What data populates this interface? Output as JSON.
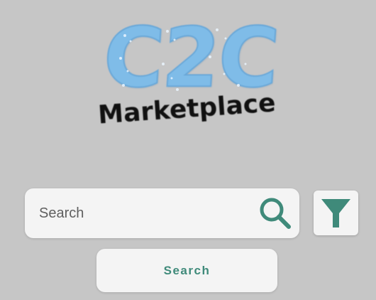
{
  "logo": {
    "title": "C2C",
    "subtitle": "Marketplace"
  },
  "search": {
    "placeholder": "Search",
    "button_label": "Search"
  },
  "icons": {
    "search": "search-icon",
    "filter": "filter-icon"
  },
  "colors": {
    "background": "#c6c6c6",
    "accent": "#3f8a7a",
    "logo_blue": "#7fbce8",
    "surface": "#f4f4f4"
  }
}
